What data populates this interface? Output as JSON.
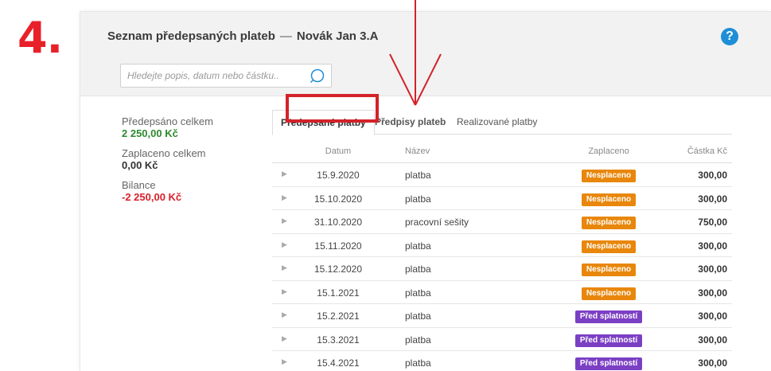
{
  "step_number": "4.",
  "header": {
    "title": "Seznam předepsaných plateb",
    "separator": "—",
    "student": "Novák Jan 3.A",
    "help_glyph": "?"
  },
  "search": {
    "placeholder": "Hledejte popis, datum nebo částku.."
  },
  "summary": {
    "prescribed_label": "Předepsáno celkem",
    "prescribed_value": "2 250,00 Kč",
    "paid_label": "Zaplaceno celkem",
    "paid_value": "0,00 Kč",
    "balance_label": "Bilance",
    "balance_value": "-2 250,00 Kč"
  },
  "tabs": [
    {
      "label": "Předepsané platby",
      "active": true
    },
    {
      "label": "Předpisy plateb",
      "active": false
    },
    {
      "label": "Realizované platby",
      "active": false
    }
  ],
  "table": {
    "columns": {
      "date": "Datum",
      "name": "Název",
      "paid": "Zaplaceno",
      "amount": "Částka Kč"
    },
    "rows": [
      {
        "date": "15.9.2020",
        "name": "platba",
        "status": "Nesplaceno",
        "status_type": "unpaid",
        "amount": "300,00"
      },
      {
        "date": "15.10.2020",
        "name": "platba",
        "status": "Nesplaceno",
        "status_type": "unpaid",
        "amount": "300,00"
      },
      {
        "date": "31.10.2020",
        "name": "pracovní sešity",
        "status": "Nesplaceno",
        "status_type": "unpaid",
        "amount": "750,00"
      },
      {
        "date": "15.11.2020",
        "name": "platba",
        "status": "Nesplaceno",
        "status_type": "unpaid",
        "amount": "300,00"
      },
      {
        "date": "15.12.2020",
        "name": "platba",
        "status": "Nesplaceno",
        "status_type": "unpaid",
        "amount": "300,00"
      },
      {
        "date": "15.1.2021",
        "name": "platba",
        "status": "Nesplaceno",
        "status_type": "unpaid",
        "amount": "300,00"
      },
      {
        "date": "15.2.2021",
        "name": "platba",
        "status": "Před splatností",
        "status_type": "due",
        "amount": "300,00"
      },
      {
        "date": "15.3.2021",
        "name": "platba",
        "status": "Před splatností",
        "status_type": "due",
        "amount": "300,00"
      },
      {
        "date": "15.4.2021",
        "name": "platba",
        "status": "Před splatností",
        "status_type": "due",
        "amount": "300,00"
      }
    ]
  },
  "colors": {
    "unpaid": "#e8870c",
    "due": "#7b3fc4",
    "annotation": "#d3222a",
    "help": "#1e8fd6"
  }
}
